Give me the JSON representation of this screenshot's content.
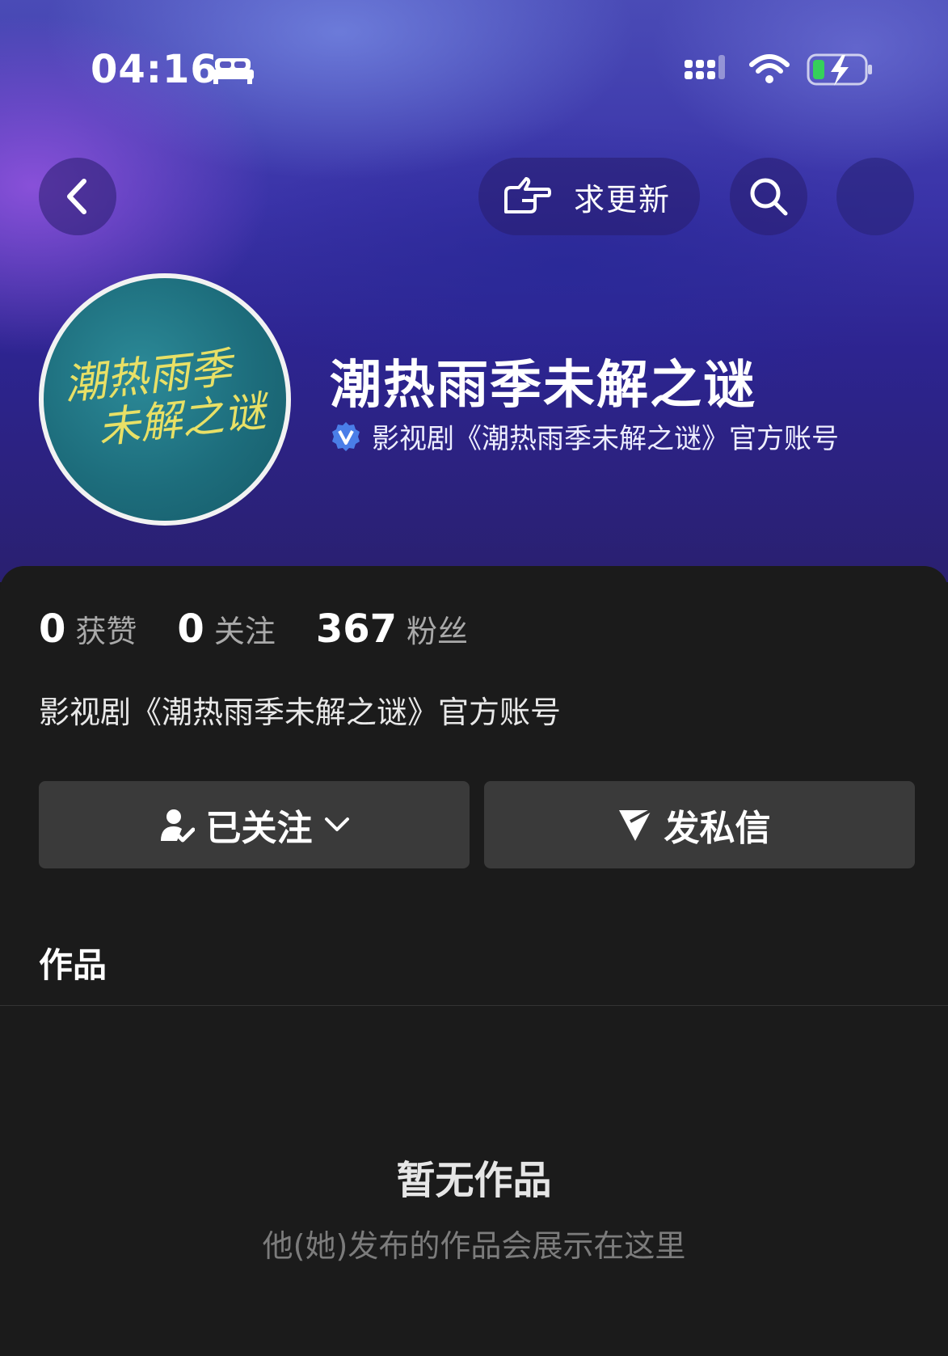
{
  "status_bar": {
    "time": "04:16",
    "icons": [
      "bed-icon",
      "signal-icon",
      "wifi-icon",
      "battery-charging-icon"
    ]
  },
  "nav": {
    "back_icon": "chevron-left-icon",
    "update_label": "求更新",
    "update_icon": "hand-pointing-icon",
    "search_icon": "search-icon"
  },
  "profile": {
    "avatar_text_line1": "潮热雨季",
    "avatar_text_line2": "未解之谜",
    "name": "潮热雨季未解之谜",
    "verified_icon": "verified-v-icon",
    "verified_text": "影视剧《潮热雨季未解之谜》官方账号"
  },
  "stats": [
    {
      "value": "0",
      "label": "获赞"
    },
    {
      "value": "0",
      "label": "关注"
    },
    {
      "value": "367",
      "label": "粉丝"
    }
  ],
  "bio": "影视剧《潮热雨季未解之谜》官方账号",
  "actions": {
    "follow_label": "已关注",
    "message_label": "发私信"
  },
  "tabs": {
    "works_label": "作品"
  },
  "empty_state": {
    "title": "暂无作品",
    "subtitle": "他(她)发布的作品会展示在这里"
  },
  "colors": {
    "sheet_bg": "#1b1b1b",
    "button_bg": "#3a3a3a",
    "verify_blue": "#4a7ee8"
  }
}
